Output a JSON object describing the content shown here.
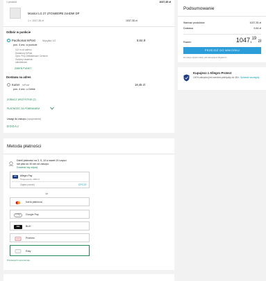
{
  "top": {
    "count_label": "1 produkt",
    "count_total": "1037,35 zł",
    "product_title": "Monitor LG 27 27GN800PB 2xHDMI DP",
    "product_qty_price": "1 × 1037,35 zł",
    "product_price": "1037,35 zł"
  },
  "pickup": {
    "heading": "Odbiór w punkcie",
    "option_name": "Paczkomat InPost",
    "option_badge": "Wysyłka 1/2",
    "option_price": "9,84 zł",
    "option_date": "pon. 4 wrz. w punkcie",
    "address_lines": [
      "112 m od adresu",
      "Dostarczy InPost",
      "Opis: Przy Delikatesach Centrum",
      "Godziny otwarcia:",
      "całodobowo"
    ],
    "change_link": "ZMIEŃ PUNKT"
  },
  "delivery": {
    "heading": "Dostawa na adres",
    "option_name": "Kurier",
    "option_badge": "InPost",
    "option_price": "18,45 zł",
    "option_date": "pon. 4 wrz. u Ciebie",
    "see_all_link": "ZOBACZ WSZYSTKIE (2)",
    "cod_link": "PŁATNOŚĆ ZA POBRANIEM"
  },
  "notes": {
    "label": "Uwagi do zakupu",
    "label_hint": "(opcjonalnie)",
    "add_link": "DODAJ"
  },
  "summary": {
    "heading": "Podsumowanie",
    "rows": [
      {
        "label": "Wartość produktów",
        "value": "1037,35 zł"
      },
      {
        "label": "Dostawa",
        "value": "9,84 zł"
      }
    ],
    "total_label": "Razem",
    "total_main": "1047,",
    "total_cents": "19",
    "total_currency": "zł",
    "pay_button": "PRZEJDŹ DO WNIOSKU",
    "terms_text": "Do zakupu dopiero kliknij, jeśli akceptujesz Regulamin"
  },
  "protect": {
    "title": "Kupujesz z Allegro Protect",
    "text": "100% zakupów jest zwrotem pieniędzy do 48 h.",
    "link": "Sprawdź szczegóły"
  },
  "payment": {
    "heading": "Metoda płatności",
    "installment_text": "Dzieli płatności na 3, 5, 10 a nawet 20 części",
    "pay_later_text": "lub płać do 30 dni od zakupu.",
    "learn_link": "Dowiedz się więcej",
    "allegro_pay": {
      "name": "Allegro Pay",
      "limit": "Twoja kwota: 4000 zł",
      "later": "Zapłać później",
      "options_link": "OPCJE"
    },
    "or_label": "lub",
    "methods": [
      {
        "label": "Karta płatnicza",
        "logo": "card-logo"
      },
      {
        "label": "Google Pay",
        "logo": "G Pay"
      },
      {
        "label": "BLIK",
        "logo": "blik"
      },
      {
        "label": "Przelew",
        "logo": "bank-logo"
      },
      {
        "label": "Raty",
        "logo": "installments-logo"
      }
    ],
    "footer_link": "Przelewy24 reprezentuje"
  }
}
